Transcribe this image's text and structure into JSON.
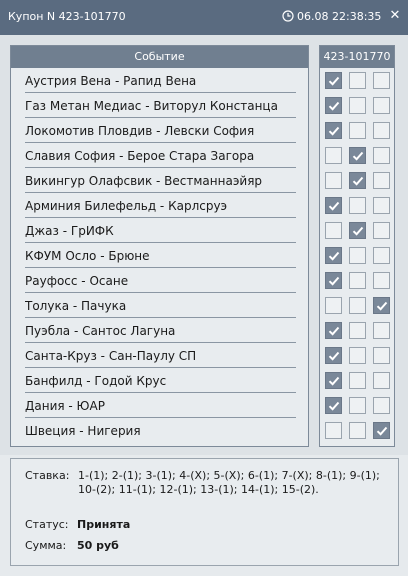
{
  "window": {
    "title": "Купон N 423-101770",
    "datetime": "06.08 22:38:35",
    "close_symbol": "✕"
  },
  "events": {
    "header": "Событие",
    "items": [
      "Аустрия Вена - Рапид Вена",
      "Газ Метан Медиас - Виторул Констанца",
      "Локомотив Пловдив - Левски София",
      "Славия София - Берое Стара Загора",
      "Викингур Олафсвик - Вестманнаэйяр",
      "Арминия Билефельд - Карлсруэ",
      "Джаз - ГрИФК",
      "КФУМ Осло - Брюне",
      "Рауфосс - Осане",
      "Толука - Пачука",
      "Пуэбла - Сантос Лагуна",
      "Санта-Круз - Сан-Паулу СП",
      "Банфилд - Годой Крус",
      "Дания - ЮАР",
      "Швеция - Нигерия"
    ]
  },
  "coupon": {
    "header": "423-101770",
    "selections": [
      0,
      0,
      0,
      1,
      1,
      0,
      1,
      0,
      0,
      2,
      0,
      0,
      0,
      0,
      2
    ]
  },
  "summary": {
    "stake_label": "Ставка:",
    "stake_text": "1-(1); 2-(1); 3-(1); 4-(X); 5-(X); 6-(1); 7-(X); 8-(1); 9-(1); 10-(2); 11-(1); 12-(1); 13-(1); 14-(1); 15-(2).",
    "status_label": "Статус:",
    "status_value": "Принята",
    "sum_label": "Сумма:",
    "sum_value": "50 руб"
  },
  "colors": {
    "titlebar": "#5a6b80",
    "header": "#707f90",
    "checked": "#7a8899"
  }
}
